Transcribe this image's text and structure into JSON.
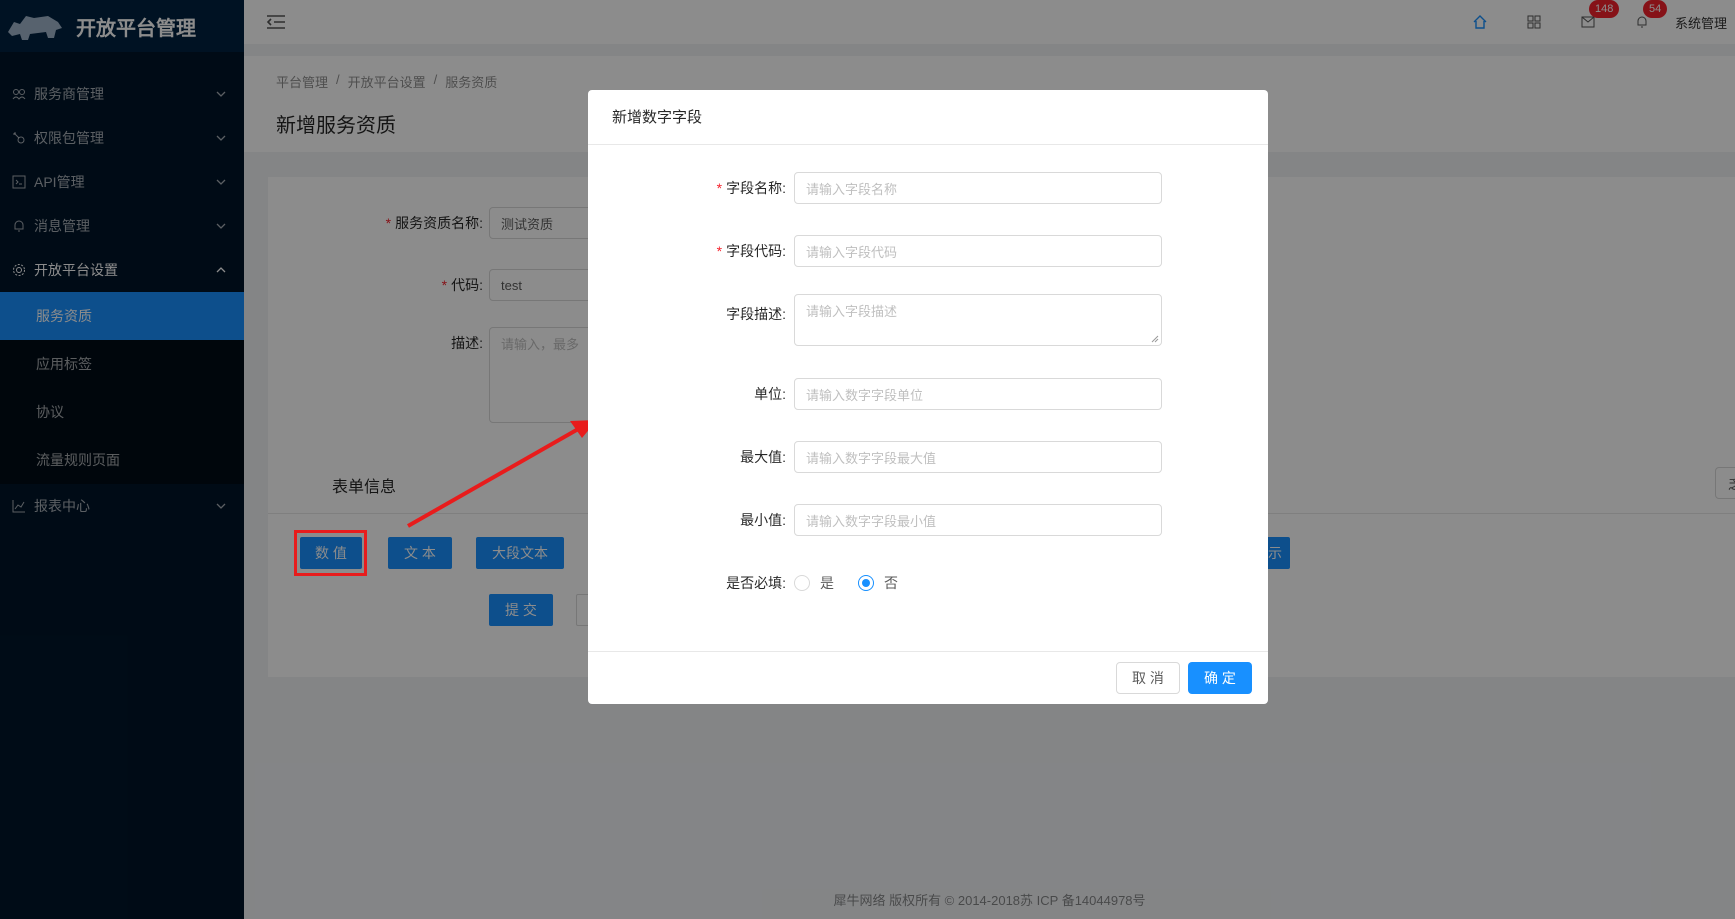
{
  "app": {
    "title": "开放平台管理"
  },
  "sidebar": {
    "items": [
      {
        "label": "服务商管理",
        "icon": "team-icon",
        "arrow": "⌄"
      },
      {
        "label": "权限包管理",
        "icon": "key-icon",
        "arrow": "⌄"
      },
      {
        "label": "API管理",
        "icon": "api-icon",
        "arrow": "⌄"
      },
      {
        "label": "消息管理",
        "icon": "bell-icon",
        "arrow": "⌄"
      },
      {
        "label": "开放平台设置",
        "icon": "gear-icon",
        "arrow": "⌃"
      },
      {
        "label": "报表中心",
        "icon": "line-chart-icon",
        "arrow": "⌄"
      }
    ],
    "subitems": [
      {
        "label": "服务资质",
        "active": true
      },
      {
        "label": "应用标签"
      },
      {
        "label": "协议"
      },
      {
        "label": "流量规则页面"
      }
    ]
  },
  "header": {
    "mail_badge": "148",
    "notice_badge": "54",
    "user": "系统管理"
  },
  "breadcrumb": [
    "平台管理",
    "开放平台设置",
    "服务资质"
  ],
  "page_title": "新增服务资质",
  "form": {
    "name_label": "服务资质名称:",
    "name_value": "测试资质",
    "code_label": "代码:",
    "code_value": "test",
    "desc_label": "描述:",
    "desc_placeholder": "请输入，最多",
    "section_title": "表单信息",
    "type_buttons": [
      "数 值",
      "文 本",
      "大段文本"
    ],
    "extra_button_fragment": "示",
    "extra_right_fragment": "乏",
    "submit": "提 交"
  },
  "modal": {
    "title": "新增数字字段",
    "fields": {
      "name_label": "字段名称:",
      "name_placeholder": "请输入字段名称",
      "code_label": "字段代码:",
      "code_placeholder": "请输入字段代码",
      "desc_label": "字段描述:",
      "desc_placeholder": "请输入字段描述",
      "unit_label": "单位:",
      "unit_placeholder": "请输入数字字段单位",
      "max_label": "最大值:",
      "max_placeholder": "请输入数字字段最大值",
      "min_label": "最小值:",
      "min_placeholder": "请输入数字字段最小值",
      "required_label": "是否必填:",
      "yes": "是",
      "no": "否",
      "required_value": "否"
    },
    "cancel": "取 消",
    "ok": "确 定"
  },
  "footer": "犀牛网络 版权所有 © 2014-2018苏 ICP 备14044978号",
  "colors": {
    "primary": "#1890ff",
    "sidebar": "#001529",
    "annotation": "#e81c1c",
    "badge": "#f5222d"
  }
}
